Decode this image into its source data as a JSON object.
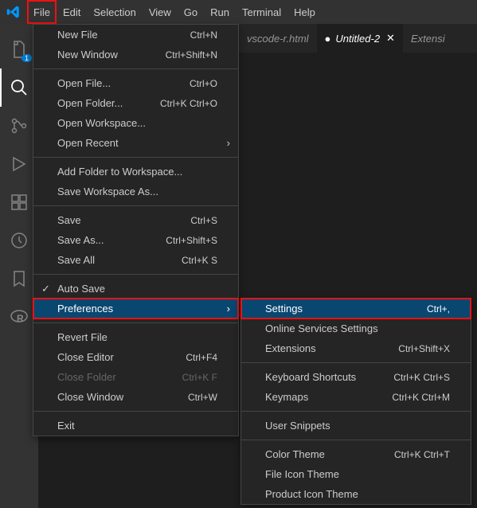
{
  "menubar": {
    "items": [
      "File",
      "Edit",
      "Selection",
      "View",
      "Go",
      "Run",
      "Terminal",
      "Help"
    ]
  },
  "tabs": {
    "left": "vscode-r.html",
    "active": "Untitled-2",
    "right": "Extensi"
  },
  "activity": {
    "badge": "1"
  },
  "fileMenu": {
    "g1": [
      {
        "label": "New File",
        "shortcut": "Ctrl+N"
      },
      {
        "label": "New Window",
        "shortcut": "Ctrl+Shift+N"
      }
    ],
    "g2": [
      {
        "label": "Open File...",
        "shortcut": "Ctrl+O"
      },
      {
        "label": "Open Folder...",
        "shortcut": "Ctrl+K Ctrl+O"
      },
      {
        "label": "Open Workspace..."
      },
      {
        "label": "Open Recent",
        "submenu": true
      }
    ],
    "g3": [
      {
        "label": "Add Folder to Workspace..."
      },
      {
        "label": "Save Workspace As..."
      }
    ],
    "g4": [
      {
        "label": "Save",
        "shortcut": "Ctrl+S"
      },
      {
        "label": "Save As...",
        "shortcut": "Ctrl+Shift+S"
      },
      {
        "label": "Save All",
        "shortcut": "Ctrl+K S"
      }
    ],
    "g5": [
      {
        "label": "Auto Save",
        "checked": true
      },
      {
        "label": "Preferences",
        "submenu": true,
        "hover": true,
        "highlight": true
      }
    ],
    "g6": [
      {
        "label": "Revert File"
      },
      {
        "label": "Close Editor",
        "shortcut": "Ctrl+F4"
      },
      {
        "label": "Close Folder",
        "shortcut": "Ctrl+K F",
        "disabled": true
      },
      {
        "label": "Close Window",
        "shortcut": "Ctrl+W"
      }
    ],
    "g7": [
      {
        "label": "Exit"
      }
    ]
  },
  "prefMenu": {
    "g1": [
      {
        "label": "Settings",
        "shortcut": "Ctrl+,",
        "hover": true,
        "highlight": true
      },
      {
        "label": "Online Services Settings"
      },
      {
        "label": "Extensions",
        "shortcut": "Ctrl+Shift+X"
      }
    ],
    "g2": [
      {
        "label": "Keyboard Shortcuts",
        "shortcut": "Ctrl+K Ctrl+S"
      },
      {
        "label": "Keymaps",
        "shortcut": "Ctrl+K Ctrl+M"
      }
    ],
    "g3": [
      {
        "label": "User Snippets"
      }
    ],
    "g4": [
      {
        "label": "Color Theme",
        "shortcut": "Ctrl+K Ctrl+T"
      },
      {
        "label": "File Icon Theme"
      },
      {
        "label": "Product Icon Theme"
      }
    ]
  }
}
